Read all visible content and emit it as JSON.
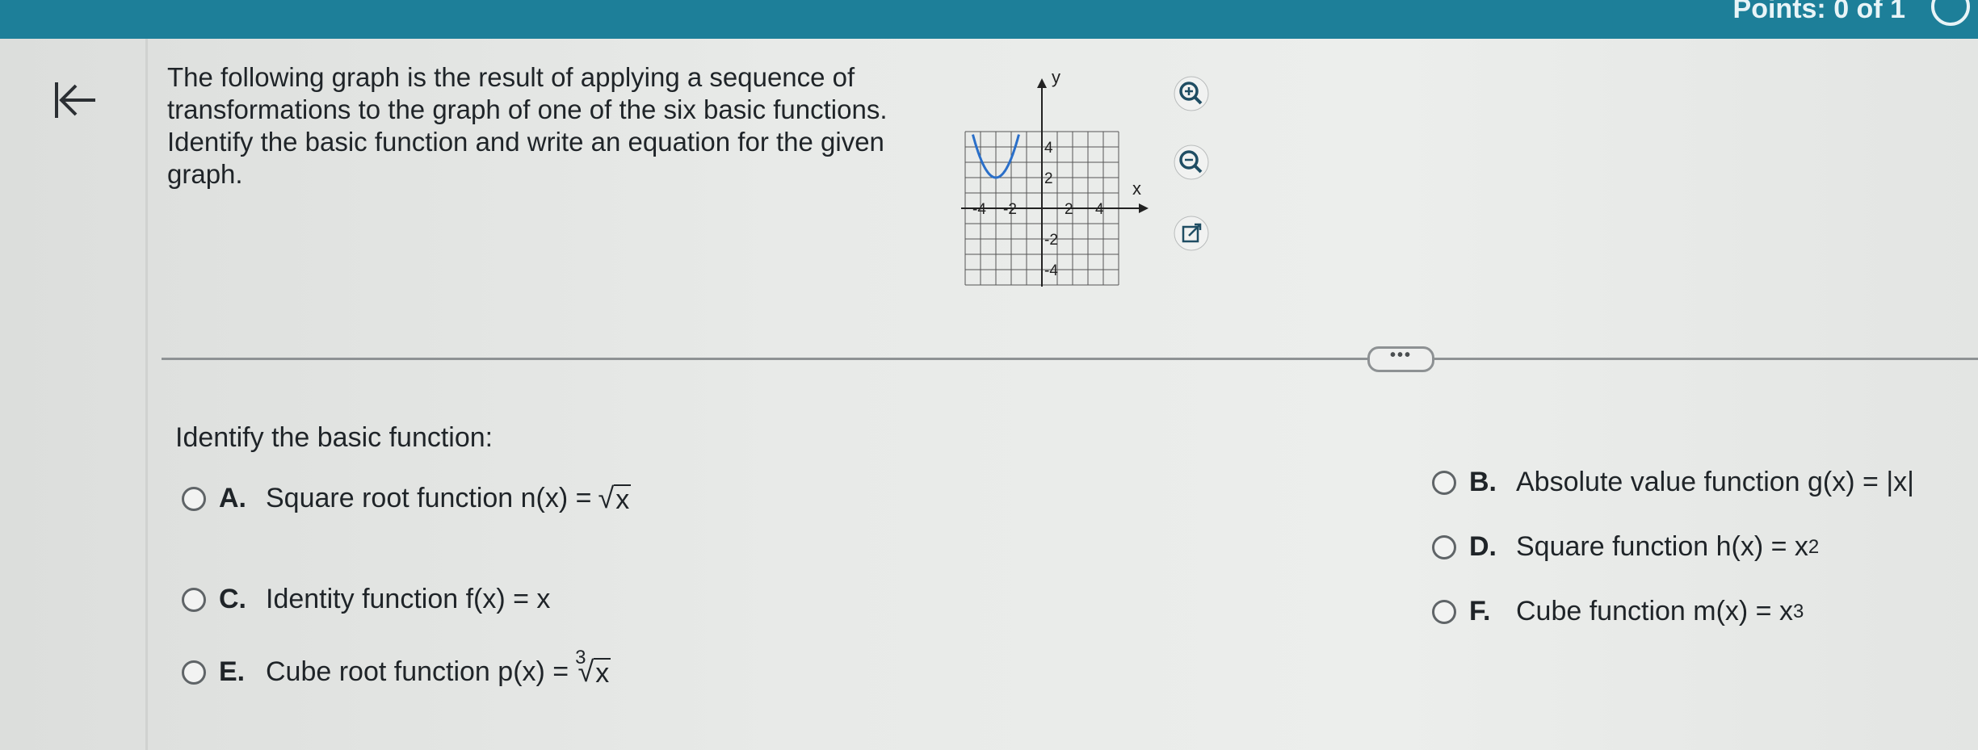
{
  "header": {
    "score_text": "Points: 0 of 1"
  },
  "question": {
    "text": "The following graph is the result of applying a sequence of transformations to the graph of one of the six basic functions. Identify the basic function and write an equation for the given graph."
  },
  "graph": {
    "y_axis_label": "y",
    "x_axis_label": "x",
    "y_tick_labels": [
      "4",
      "2",
      "-2",
      "-4"
    ],
    "x_tick_labels": [
      "-4",
      "-2",
      "2",
      "4"
    ],
    "grid_range": {
      "xmin": -5,
      "xmax": 5,
      "ymin": -5,
      "ymax": 5
    },
    "curve_color": "#2a6fc9",
    "curve": {
      "type": "parabola",
      "vertex": [
        -3,
        2
      ],
      "a": 1.25
    }
  },
  "tools": {
    "zoom_in_icon": "zoom-in-icon",
    "zoom_out_icon": "zoom-out-icon",
    "popout_icon": "external-link-icon"
  },
  "more_button": {
    "label": "•••"
  },
  "answer": {
    "prompt": "Identify the basic function:",
    "options": [
      {
        "letter": "A.",
        "text": "Square root function n(x) = ",
        "radicand": "x"
      },
      {
        "letter": "C.",
        "text": "Identity function f(x) = x"
      },
      {
        "letter": "E.",
        "text": "Cube root function p(x) = ",
        "index": "3",
        "radicand": "x"
      },
      {
        "letter": "B.",
        "text": "Absolute value function g(x) = |x|"
      },
      {
        "letter": "D.",
        "text": "Square function h(x) = x",
        "exponent": "2"
      },
      {
        "letter": "F.",
        "text": "Cube function m(x) = x",
        "exponent": "3"
      }
    ]
  }
}
